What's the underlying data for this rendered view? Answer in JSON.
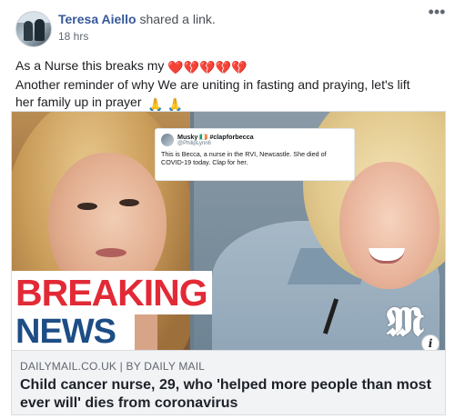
{
  "post": {
    "author": "Teresa Aiello",
    "action": "shared a link.",
    "timestamp": "18 hrs",
    "more_icon": "ellipsis-icon",
    "text_line1": "As a Nurse this breaks my",
    "hearts": "❤️💔💔💔💔",
    "text_line2": "Another reminder of why We are uniting in fasting and praying, let's lift",
    "text_line3": "her family up in prayer",
    "pray": "🙏 🙏"
  },
  "link": {
    "tweet": {
      "name": "Musky 🇮🇪 #clapforbecca",
      "handle": "@PhilipLynn6",
      "body": "This is Becca, a nurse in the RVI, Newcastle. She died of COVID-19 today. Clap for her."
    },
    "overlay_line1": "BREAKING",
    "overlay_line2": "NEWS",
    "logo_glyph": "𝕸",
    "info_glyph": "i",
    "domain": "DAILYMAIL.CO.UK | BY DAILY MAIL",
    "title": "Child cancer nurse, 29, who 'helped more people than most ever will' dies from coronavirus"
  },
  "colors": {
    "name_link": "#365899",
    "breaking_red": "#e22a36",
    "news_blue": "#1d4d86",
    "caption_bg": "#f2f3f5"
  }
}
